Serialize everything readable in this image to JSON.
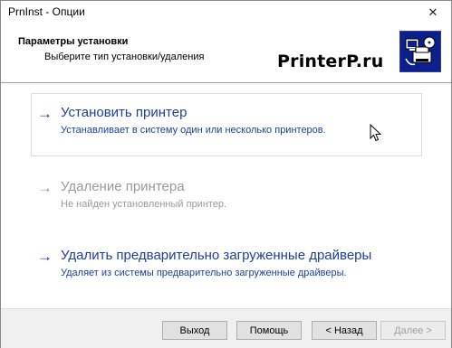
{
  "window": {
    "title": "PrnInst - Опции",
    "close_glyph": "✕"
  },
  "header": {
    "title": "Параметры установки",
    "subtitle": "Выберите тип установки/удаления",
    "watermark": "PrinterP.ru",
    "icon": "printer-setup-icon"
  },
  "options": [
    {
      "arrow": "→",
      "title": "Установить принтер",
      "description": "Устанавливает в систему один или несколько принтеров.",
      "state": "enabled"
    },
    {
      "arrow": "→",
      "title": "Удаление принтера",
      "description": "Не найден установленный принтер.",
      "state": "disabled"
    },
    {
      "arrow": "→",
      "title": "Удалить предварительно загруженные драйверы",
      "description": "Удаляет из системы предварительно загруженные драйверы.",
      "state": "enabled"
    }
  ],
  "footer": {
    "exit_label": "Выход",
    "help_label": "Помощь",
    "back_label": "< Назад",
    "next_label": "Далее >"
  },
  "colors": {
    "link": "#1a3fa0",
    "disabled": "#9a9a9a",
    "icon_bg": "#0c1f8c"
  }
}
